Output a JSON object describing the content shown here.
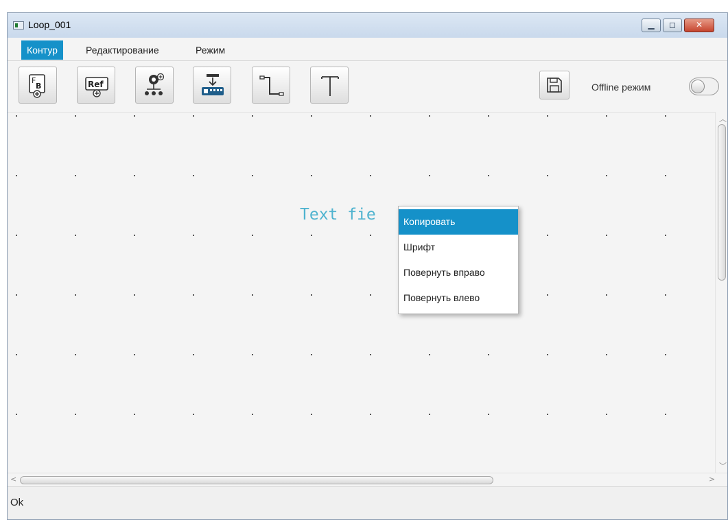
{
  "window": {
    "title": "Loop_001",
    "controls": {
      "minimize_icon": "minimize-icon",
      "maximize_icon": "maximize-icon",
      "close_icon": "close-icon"
    }
  },
  "menubar": {
    "items": [
      {
        "label": "Контур",
        "active": true
      },
      {
        "label": "Редактирование",
        "active": false
      },
      {
        "label": "Режим",
        "active": false
      }
    ]
  },
  "toolbar": {
    "buttons": [
      {
        "icon": "fb-block-add-icon"
      },
      {
        "icon": "ref-add-icon"
      },
      {
        "icon": "device-network-add-icon"
      },
      {
        "icon": "io-module-icon"
      },
      {
        "icon": "connector-line-icon"
      },
      {
        "icon": "text-tool-icon"
      },
      {
        "icon": "save-icon"
      }
    ],
    "offline_label": "Offline режим",
    "offline_enabled": false
  },
  "canvas": {
    "text_field": "Text fie"
  },
  "context_menu": {
    "items": [
      {
        "label": "Копировать",
        "active": true
      },
      {
        "label": "Шрифт",
        "active": false
      },
      {
        "label": "Повернуть вправо",
        "active": false
      },
      {
        "label": "Повернуть влево",
        "active": false
      }
    ]
  },
  "statusbar": {
    "text": "Ok"
  },
  "colors": {
    "accent": "#1591c9",
    "canvas_text": "#4fb3cf",
    "close_button": "#c6452f"
  }
}
